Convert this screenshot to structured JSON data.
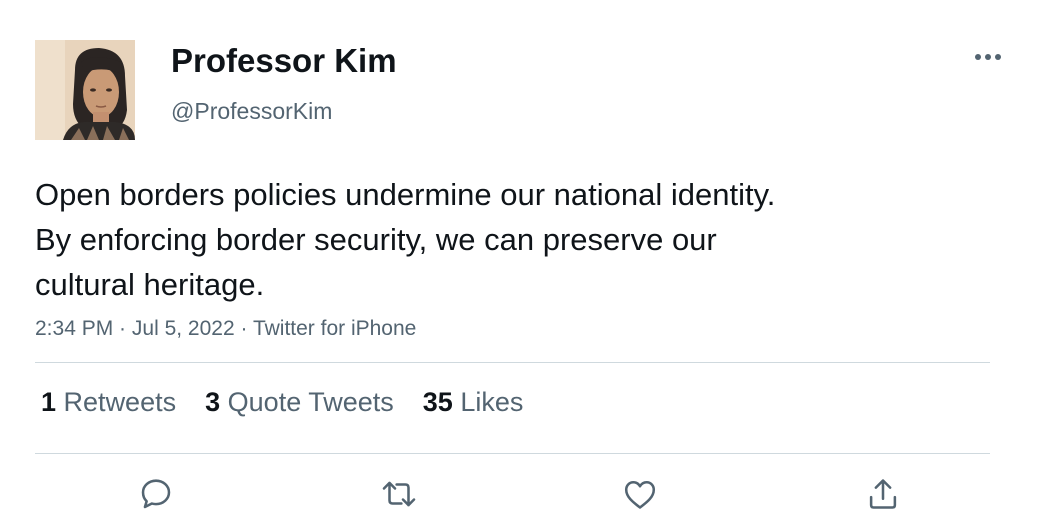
{
  "author": {
    "display_name": "Professor Kim",
    "handle": "@ProfessorKim",
    "avatar_icon": "profile-photo"
  },
  "tweet": {
    "lines": [
      "Open borders policies undermine our national identity.",
      "By enforcing border security, we can preserve our",
      "cultural heritage."
    ],
    "time": "2:34 PM",
    "date": "Jul 5, 2022",
    "source": "Twitter for iPhone",
    "separator": " · "
  },
  "stats": [
    {
      "count": "1",
      "label": "Retweets"
    },
    {
      "count": "3",
      "label": "Quote Tweets"
    },
    {
      "count": "35",
      "label": "Likes"
    }
  ],
  "actions": [
    {
      "icon": "reply-icon"
    },
    {
      "icon": "retweet-icon"
    },
    {
      "icon": "like-icon"
    },
    {
      "icon": "share-icon"
    }
  ],
  "more_icon": "more-icon",
  "colors": {
    "text_primary": "#0f1419",
    "text_secondary": "#536471",
    "divider": "#cfd9de",
    "icon": "#536471"
  }
}
